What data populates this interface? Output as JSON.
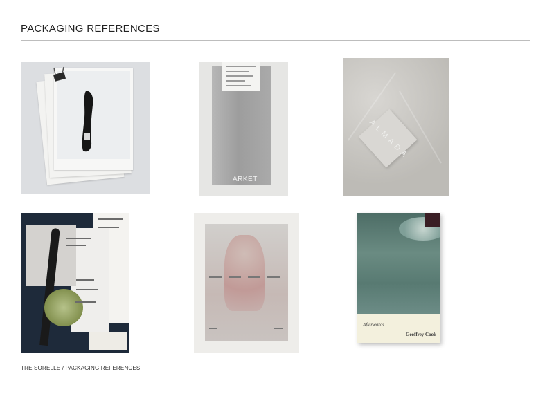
{
  "header": {
    "title": "PACKAGING REFERENCES"
  },
  "tiles": {
    "arket": {
      "brand": "ARKET"
    },
    "almada": {
      "letters": "ALMADA"
    },
    "book": {
      "title": "Afterwards",
      "author": "Geoffrey Cook"
    }
  },
  "footer": {
    "text": "TRE SORELLE / PACKAGING REFERENCES"
  }
}
